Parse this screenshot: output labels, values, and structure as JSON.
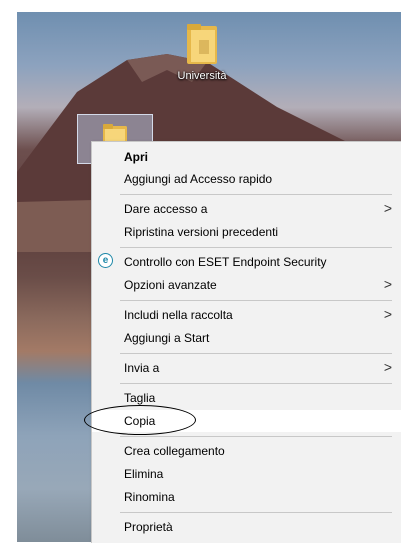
{
  "desktop": {
    "icons": [
      {
        "label": "Università"
      }
    ]
  },
  "context_menu": {
    "items": [
      {
        "label": "Apri",
        "bold": true
      },
      {
        "label": "Aggiungi ad Accesso rapido"
      },
      {
        "label": "Dare accesso a",
        "submenu": true
      },
      {
        "label": "Ripristina versioni precedenti"
      },
      {
        "label": "Controllo con ESET Endpoint Security",
        "icon": "eset-icon"
      },
      {
        "label": "Opzioni avanzate",
        "submenu": true
      },
      {
        "label": "Includi nella raccolta",
        "submenu": true
      },
      {
        "label": "Aggiungi a Start"
      },
      {
        "label": "Invia a",
        "submenu": true
      },
      {
        "label": "Taglia"
      },
      {
        "label": "Copia",
        "highlighted": true
      },
      {
        "label": "Crea collegamento"
      },
      {
        "label": "Elimina"
      },
      {
        "label": "Rinomina"
      },
      {
        "label": "Proprietà"
      }
    ],
    "submenu_glyph": ">",
    "eset_glyph": "e"
  }
}
